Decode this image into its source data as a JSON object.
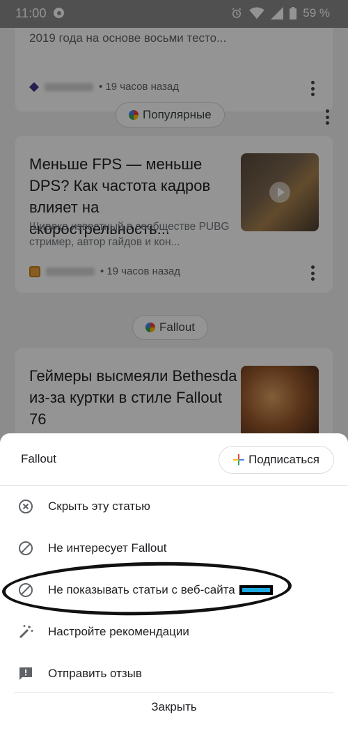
{
  "status_bar": {
    "time": "11:00",
    "battery_percent": "59 %"
  },
  "feed": {
    "prev_card": {
      "snippet": "2019 года на основе восьми тесто...",
      "time_ago": "• 19 часов назад"
    },
    "card1": {
      "topic": "Популярные",
      "headline": "Меньше FPS — меньше DPS? Как частота кадров влияет на скорострельность...",
      "description": "Широко известный в сообществе PUBG стример, автор гайдов и кон...",
      "time_ago": "• 19 часов назад"
    },
    "card2": {
      "topic": "Fallout",
      "headline": "Геймеры высмеяли Bethesda из-за куртки в стиле Fallout 76"
    }
  },
  "sheet": {
    "title": "Fallout",
    "subscribe_label": "Подписаться",
    "options": [
      {
        "label": "Скрыть эту статью",
        "icon": "close-circle-icon"
      },
      {
        "label": "Не интересует Fallout",
        "icon": "block-icon"
      },
      {
        "label": "Не показывать статьи с веб-сайта",
        "icon": "block-icon"
      },
      {
        "label": "Настройте рекомендации",
        "icon": "magic-wand-icon"
      },
      {
        "label": "Отправить отзыв",
        "icon": "feedback-icon"
      }
    ],
    "close_label": "Закрыть"
  },
  "colors": {
    "scrim": "#000000",
    "redaction_accent": "#1ba8e0"
  }
}
